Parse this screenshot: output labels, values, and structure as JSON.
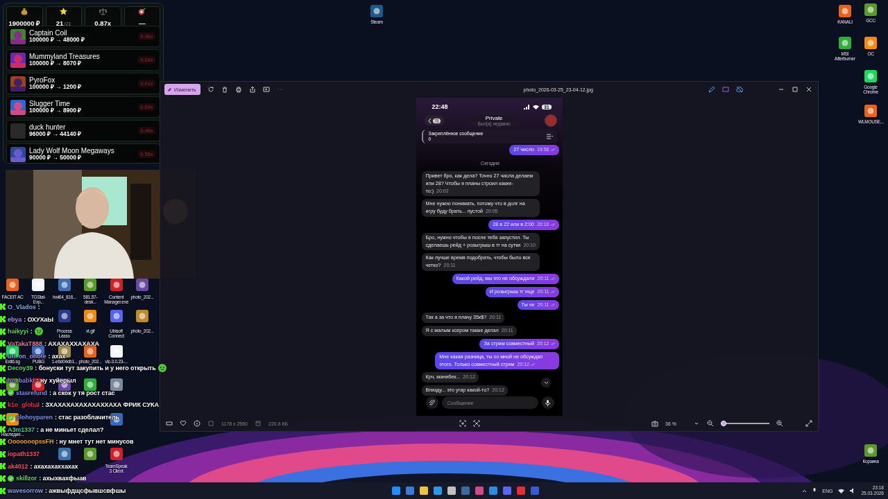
{
  "widget": {
    "stats": [
      {
        "kind": "money",
        "value": "1900000 ₽"
      },
      {
        "kind": "star",
        "value": "21",
        "total": "/21"
      },
      {
        "kind": "scale",
        "value": "0.87x"
      },
      {
        "kind": "target",
        "value": "—"
      }
    ],
    "games": [
      {
        "name": "Captain Coil",
        "amounts": "100000 ₽ → 48000 ₽",
        "multiplier": "0.48x",
        "kind": "picture"
      },
      {
        "name": "Mummyland Treasures",
        "amounts": "100000 ₽ → 8070 ₽",
        "multiplier": "0.08x",
        "kind": "picture"
      },
      {
        "name": "PyroFox",
        "amounts": "100000 ₽ → 1200 ₽",
        "multiplier": "0.01x",
        "kind": "picture"
      },
      {
        "name": "Slugger Time",
        "amounts": "100000 ₽ → 8900 ₽",
        "multiplier": "0.09x",
        "kind": "picture"
      },
      {
        "name": "duck hunter",
        "amounts": "96000 ₽ → 44140 ₽",
        "multiplier": "0.46x",
        "kind": "blank"
      },
      {
        "name": "Lady Wolf Moon Megaways",
        "amounts": "90000 ₽ → 50000 ₽",
        "multiplier": "0.56x",
        "kind": "picture"
      }
    ]
  },
  "viewer": {
    "edit_button": "Изменить",
    "title": "photo_2026-03-25_23-04-12.jpg",
    "dimensions": "1178 x 2560",
    "file_size": "220.6 КБ",
    "zoom": "36 %",
    "zoom_slider": {
      "level": 0.05
    }
  },
  "phone": {
    "time": "22:48",
    "battery": "31",
    "back_count": "78",
    "contact": "Private",
    "status": "был(а) недавно",
    "pinned_title": "Закреплённое сообщение",
    "pinned_text": "0",
    "messages": [
      {
        "kind": "out",
        "text": "27 число",
        "time": "19:56",
        "read": true
      },
      {
        "kind": "date",
        "text": "Сегодня"
      },
      {
        "kind": "in",
        "text": "Привет бро, как дела? Точно 27 числа делаем или 28? Чтобы я планы строил какие-то:)",
        "time": "20:02"
      },
      {
        "kind": "in",
        "text": "Мне нужно понимать, потому что в долг на игру буду брать... пустой",
        "time": "20:05"
      },
      {
        "kind": "out",
        "text": "28 в 22 или в 2:00",
        "time": "20:10",
        "read": true
      },
      {
        "kind": "in",
        "text": "Бро, нужно чтобы я после тебя запустил. Ты сделаешь рейд + розыгрыш в тг на сутки",
        "time": "20:10"
      },
      {
        "kind": "in",
        "text": "Как лучше время подобрать, чтобы было все четко?",
        "time": "20:11"
      },
      {
        "kind": "out",
        "text": "Какой рейд, мы это не обсуждали",
        "time": "20:11",
        "read": true
      },
      {
        "kind": "out",
        "text": "И розыгрыш тг нще",
        "time": "20:11",
        "read": true
      },
      {
        "kind": "out",
        "text": "Ты че",
        "time": "20:11",
        "read": true
      },
      {
        "kind": "in",
        "text": "Так а за что я плачу 35к$?",
        "time": "20:11"
      },
      {
        "kind": "in",
        "text": "Я с малым ксером также делал",
        "time": "20:11"
      },
      {
        "kind": "out",
        "text": "За стрим совместный",
        "time": "20:12",
        "read": true
      },
      {
        "kind": "out",
        "text": "Мне какая разница, ты со мной не обсуждал этого. Только совместный стрим",
        "time": "20:12",
        "read": true
      },
      {
        "kind": "in",
        "text": "Крч, манибек...",
        "time": "20:12"
      },
      {
        "kind": "in",
        "text": "Впизду... это угар какой-то?",
        "time": "20:12"
      }
    ],
    "input_placeholder": "Сообщение"
  },
  "desktop_left": [
    [
      {
        "label": "FACEIT AC"
      },
      {
        "label": "TGStat-Exp..."
      },
      {
        "label": "hwi64_816..."
      },
      {
        "label": "581.57-desk..."
      },
      {
        "label": "Content Manager.exe"
      },
      {
        "label": "photo_202..."
      }
    ],
    [
      {
        "label": "Process Lasso"
      },
      {
        "label": "xt.gif"
      },
      {
        "label": "Ubisoft Connect"
      },
      {
        "label": "photo_202..."
      }
    ],
    [
      {
        "label": "Exit6.sg"
      },
      {
        "label": "PUBG"
      },
      {
        "label": "1-e6d04db1..."
      },
      {
        "label": "photo_202..."
      },
      {
        "label": "vlc-3.0.23-..."
      }
    ],
    [
      {
        "label": "Наследие..."
      }
    ],
    [
      {
        "label": "TeamSpeak 3 Client"
      }
    ]
  ],
  "desktop_right": [
    {
      "label": "KANALI"
    },
    {
      "label": "GCC"
    },
    {
      "label": "MSI Afterburner"
    },
    {
      "label": "OC"
    },
    {
      "label": "Google Chrome"
    },
    {
      "label": "WLMOUSE..."
    },
    {
      "label": "Корзина"
    }
  ],
  "desktop_top": {
    "label": "Steam"
  },
  "chat": [
    {
      "user": "O_Vlados",
      "color": "#7fa6e0",
      "verified": false,
      "text": ":",
      "emote": false
    },
    {
      "user": "ebya",
      "color": "#a98be8",
      "verified": false,
      "text": ": ОХУХаЫ",
      "emote": false
    },
    {
      "user": "haikyyi",
      "color": "#5ed35e",
      "verified": false,
      "text": ":",
      "emote": true
    },
    {
      "user": "VaTakaT888",
      "color": "#e07ba0",
      "verified": false,
      "text": ": АХАХАХХАХАХА",
      "emote": false
    },
    {
      "user": "un_on_ohote",
      "color": "#a68be8",
      "verified": false,
      "text": ": ахах",
      "emote": false
    },
    {
      "user": "Decoy39",
      "color": "#5ed35e",
      "verified": false,
      "text": ": бонуски тут закупить и у него открыть",
      "emote": true
    },
    {
      "user": "ho_babki",
      "color": "#8a7de8",
      "verified": false,
      "text": ": ну хуйерыл",
      "emote": false
    },
    {
      "user": "stasrefund",
      "color": "#7d8ee8",
      "verified": true,
      "text": ": а скок у тя рост стас",
      "emote": false
    },
    {
      "user": "k1o_global",
      "color": "#e0334a",
      "verified": false,
      "text": ": ЗХАХАХАХАХАХАХХАХА ФРИК СУКА",
      "emote": false
    },
    {
      "user": "plohoyparen",
      "color": "#7d8ee8",
      "verified": true,
      "text": ": стас разоблачитель",
      "emote": false
    },
    {
      "user": "A3m1337",
      "color": "#4fc48a",
      "verified": false,
      "text": ": а не миньет сделал?",
      "emote": false
    },
    {
      "user": "OoooooopssFH",
      "color": "#f0a030",
      "verified": false,
      "text": ": ну мнет тут нет минусов",
      "emote": false
    },
    {
      "user": "iopath1337",
      "color": "#ff4a6a",
      "verified": false,
      "emote": false
    },
    {
      "user": "ak4012",
      "color": "#ff4a6a",
      "verified": false,
      "text": ": ахахахаххахах",
      "emote": false
    },
    {
      "user": "skillzor",
      "color": "#5ed35e",
      "verified": true,
      "text": ": ахыхвахфыав",
      "emote": false
    },
    {
      "user": "wavesorrow",
      "color": "#8aa0e8",
      "verified": false,
      "text": ": ажвыфдщсфывшсвфшы",
      "emote": false
    }
  ],
  "taskbar": {
    "language": "ENG",
    "time": "23:18",
    "date": "25.03.2026"
  }
}
